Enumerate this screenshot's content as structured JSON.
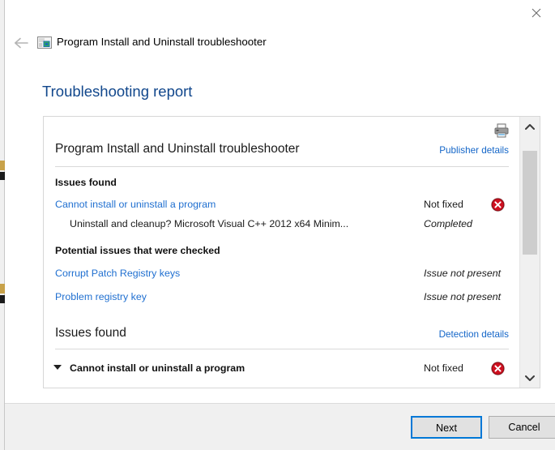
{
  "window": {
    "app_title": "Program Install and Uninstall troubleshooter",
    "app_icon": "program-install-uninstall-icon",
    "close_icon": "close-icon",
    "back_icon": "back-arrow-icon",
    "page_title": "Troubleshooting report"
  },
  "report": {
    "print_icon": "printer-icon",
    "heading": "Program Install and Uninstall troubleshooter",
    "publisher_details_link": "Publisher details",
    "sections": [
      {
        "title": "Issues found",
        "rows": [
          {
            "label": "Cannot install or uninstall a program",
            "style": "link",
            "status": "Not fixed",
            "status_style": "normal",
            "icon": "error-icon"
          },
          {
            "label": "Uninstall and cleanup? Microsoft Visual C++ 2012 x64 Minim...",
            "style": "indent",
            "status": "Completed",
            "status_style": "italic",
            "icon": ""
          }
        ]
      },
      {
        "title": "Potential issues that were checked",
        "rows": [
          {
            "label": "Corrupt Patch Registry keys",
            "style": "link",
            "status": "Issue not present",
            "status_style": "italic",
            "icon": ""
          },
          {
            "label": "Problem registry key",
            "style": "link",
            "status": "Issue not present",
            "status_style": "italic",
            "icon": ""
          }
        ]
      }
    ],
    "issues_found_2": {
      "title": "Issues found",
      "detection_details_link": "Detection details",
      "row": {
        "label": "Cannot install or uninstall a program",
        "status": "Not fixed",
        "icon": "error-icon",
        "caret": "caret-down-icon"
      }
    }
  },
  "scrollbar": {
    "up_icon": "chevron-up-icon",
    "down_icon": "chevron-down-icon"
  },
  "footer": {
    "next_label": "Next",
    "cancel_label": "Cancel"
  },
  "colors": {
    "link": "#1f6fd0",
    "heading": "#11478c",
    "accent": "#0078d7",
    "error": "#cc0000"
  }
}
